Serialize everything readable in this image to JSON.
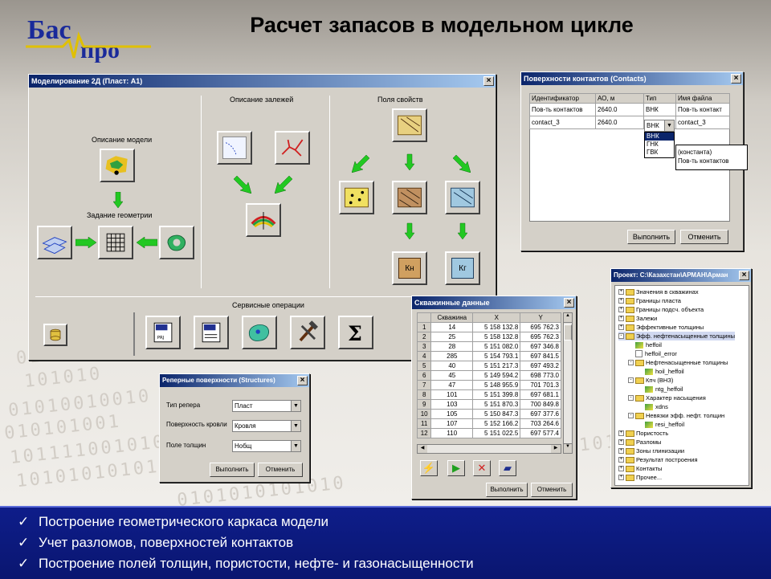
{
  "slide": {
    "title": "Расчет запасов в модельном цикле",
    "logo": {
      "top": "Бас",
      "bottom": "про"
    }
  },
  "background_binary": [
    "01011",
    "101010",
    "01010010010",
    "010101001",
    "101111001010",
    "10101010101",
    "0101010101010",
    "0101010101010"
  ],
  "win_model": {
    "title": "Моделирование 2Д (Пласт: А1)",
    "sec_model": "Описание модели",
    "sec_geometry": "Задание геометрии",
    "sec_deposits": "Описание залежей",
    "sec_fields": "Поля свойств",
    "sec_service": "Сервисные операции",
    "icon_kn": "Кн",
    "icon_kg": "Кг"
  },
  "win_contacts": {
    "title": "Поверхности контактов (Contacts)",
    "headers": [
      "Идентификатор",
      "АО, м",
      "Тип",
      "Имя файла"
    ],
    "rows": [
      [
        "Пов-ть контактов",
        "2640.0",
        "ВНК",
        "Пов-ть контакт"
      ],
      [
        "contact_3",
        "2640.0",
        "ВНК",
        "contact_3"
      ]
    ],
    "type_options": [
      "ВНК",
      "ГНК",
      "ГВК"
    ],
    "file_options": [
      "(константа)",
      "Пов-ть контактов"
    ],
    "run_label": "Выполнить",
    "cancel_label": "Отменить"
  },
  "win_wells": {
    "title": "Скважинные данные",
    "headers": [
      "",
      "Скважина",
      "X",
      "Y"
    ],
    "rows": [
      [
        "1",
        "14",
        "5 158 132.8",
        "695 762.3"
      ],
      [
        "2",
        "25",
        "5 158 132.8",
        "695 762.3"
      ],
      [
        "3",
        "28",
        "5 151 082.0",
        "697 346.8"
      ],
      [
        "4",
        "285",
        "5 154 793.1",
        "697 841.5"
      ],
      [
        "5",
        "40",
        "5 151 217.3",
        "697 493.2"
      ],
      [
        "6",
        "45",
        "5 149 594.2",
        "698 773.0"
      ],
      [
        "7",
        "47",
        "5 148 955.9",
        "701 701.3"
      ],
      [
        "8",
        "101",
        "5 151 399.8",
        "697 681.1"
      ],
      [
        "9",
        "103",
        "5 151 870.3",
        "700 849.8"
      ],
      [
        "10",
        "105",
        "5 150 847.3",
        "697 377.6"
      ],
      [
        "11",
        "107",
        "5 152 166.2",
        "703 264.6"
      ],
      [
        "12",
        "110",
        "5 151 022.5",
        "697 577.4"
      ]
    ],
    "run_label": "Выполнить",
    "cancel_label": "Отменить"
  },
  "win_structures": {
    "title": "Реперные поверхности (Structures)",
    "labels": [
      "Тип репера",
      "Поверхность кровли",
      "Поле толщин"
    ],
    "values": [
      "Пласт",
      "Кровля",
      "Нобщ"
    ],
    "run_label": "Выполнить",
    "cancel_label": "Отменить"
  },
  "win_project": {
    "title": "Проект: С:\\Казахстан\\АРМАН\\Арман",
    "items": [
      {
        "label": "Значения в скважинах",
        "level": 0,
        "kind": "folder",
        "pm": "+"
      },
      {
        "label": "Границы пласта",
        "level": 0,
        "kind": "folder",
        "pm": "+"
      },
      {
        "label": "Границы подсч. объекта",
        "level": 0,
        "kind": "folder",
        "pm": "+"
      },
      {
        "label": "Залежи",
        "level": 0,
        "kind": "folder",
        "pm": "+"
      },
      {
        "label": "Эффективные толщины",
        "level": 0,
        "kind": "folder",
        "pm": "+"
      },
      {
        "label": "Эфф. нефтенасыщенные толщины",
        "level": 0,
        "kind": "folder",
        "pm": "-",
        "selected": true
      },
      {
        "label": "heffoil",
        "level": 1,
        "kind": "leaf"
      },
      {
        "label": "heffoil_error",
        "level": 1,
        "kind": "doc"
      },
      {
        "label": "Нефтенасыщенные толщины",
        "level": 1,
        "kind": "folder",
        "pm": "-"
      },
      {
        "label": "hoil_heffoil",
        "level": 2,
        "kind": "leaf"
      },
      {
        "label": "Кпч (ВНЗ)",
        "level": 1,
        "kind": "folder",
        "pm": "-"
      },
      {
        "label": "ntg_heffoil",
        "level": 2,
        "kind": "leaf"
      },
      {
        "label": "Характер насыщения",
        "level": 1,
        "kind": "folder",
        "pm": "-"
      },
      {
        "label": "xdns",
        "level": 2,
        "kind": "leaf"
      },
      {
        "label": "Невязки эфф. нефт. толщин",
        "level": 1,
        "kind": "folder",
        "pm": "-"
      },
      {
        "label": "resi_heffoil",
        "level": 2,
        "kind": "leaf"
      },
      {
        "label": "Пористость",
        "level": 0,
        "kind": "folder",
        "pm": "+"
      },
      {
        "label": "Разломы",
        "level": 0,
        "kind": "folder",
        "pm": "+"
      },
      {
        "label": "Зоны глинизации",
        "level": 0,
        "kind": "folder",
        "pm": "+"
      },
      {
        "label": "Результат построения",
        "level": 0,
        "kind": "folder",
        "pm": "+"
      },
      {
        "label": "Контакты",
        "level": 0,
        "kind": "folder",
        "pm": "+"
      },
      {
        "label": "Прочее...",
        "level": 0,
        "kind": "folder",
        "pm": "+"
      }
    ]
  },
  "bullets": [
    "Построение геометрического каркаса модели",
    "Учет разломов, поверхностей контактов",
    "Построение полей толщин, пористости, нефте- и газонасыщенности"
  ],
  "colors": {
    "titlebar": "#0a246a",
    "bottom_band": "#0e1d8a",
    "window": "#d4d0c8",
    "arrow": "#22c822"
  }
}
